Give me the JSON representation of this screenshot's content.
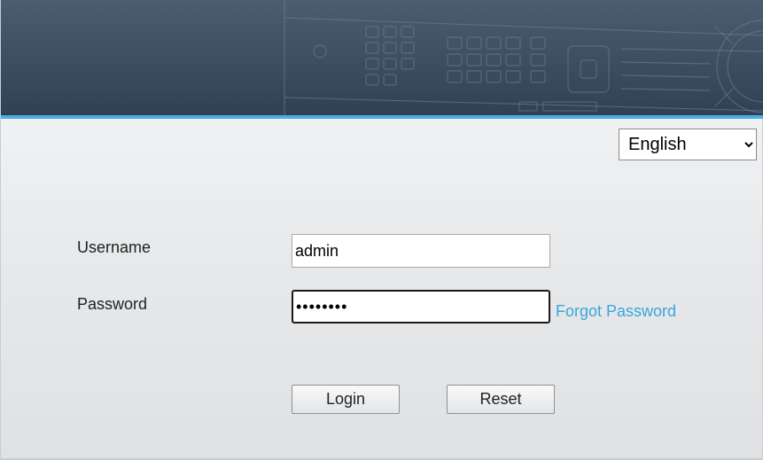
{
  "language": {
    "selected": "English"
  },
  "form": {
    "username_label": "Username",
    "username_value": "admin",
    "password_label": "Password",
    "password_value": "12345678",
    "forgot_password": "Forgot Password"
  },
  "buttons": {
    "login": "Login",
    "reset": "Reset"
  },
  "colors": {
    "banner": "#3a4d5f",
    "accent_line": "#4aaee0",
    "link": "#3aa6dd"
  }
}
